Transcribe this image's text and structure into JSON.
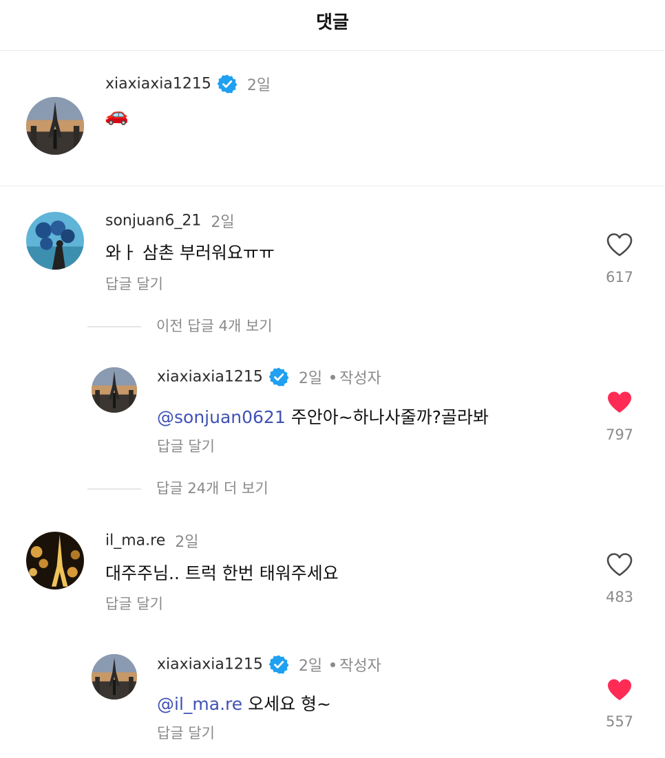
{
  "header": {
    "title": "댓글"
  },
  "post": {
    "username": "xiaxiaxia1215",
    "time": "2일",
    "text": "🚗"
  },
  "comments": [
    {
      "username": "sonjuan6_21",
      "time": "2일",
      "text": "와ㅏ 삼촌 부러워요ㅠㅠ",
      "reply_label": "답글 달기",
      "likes": "617",
      "liked": false,
      "view_more": "이전 답글 4개 보기",
      "replies": [
        {
          "username": "xiaxiaxia1215",
          "time": "2일",
          "author_badge": "작성자",
          "mention": "@sonjuan0621",
          "text": " 주안아~하나사줄까?골라봐",
          "reply_label": "답글 달기",
          "likes": "797",
          "liked": true
        }
      ],
      "view_more_after": "답글 24개 더 보기"
    },
    {
      "username": "il_ma.re",
      "time": "2일",
      "text": "대주주님.. 트럭 한번 태워주세요",
      "reply_label": "답글 달기",
      "likes": "483",
      "liked": false,
      "replies": [
        {
          "username": "xiaxiaxia1215",
          "time": "2일",
          "author_badge": "작성자",
          "mention": "@il_ma.re",
          "text": " 오세요 형~",
          "reply_label": "답글 달기",
          "likes": "557",
          "liked": true
        }
      ]
    }
  ],
  "colors": {
    "heart_active": "#fe2c55",
    "verified": "#20a0f0",
    "mention": "#3f51b5"
  }
}
